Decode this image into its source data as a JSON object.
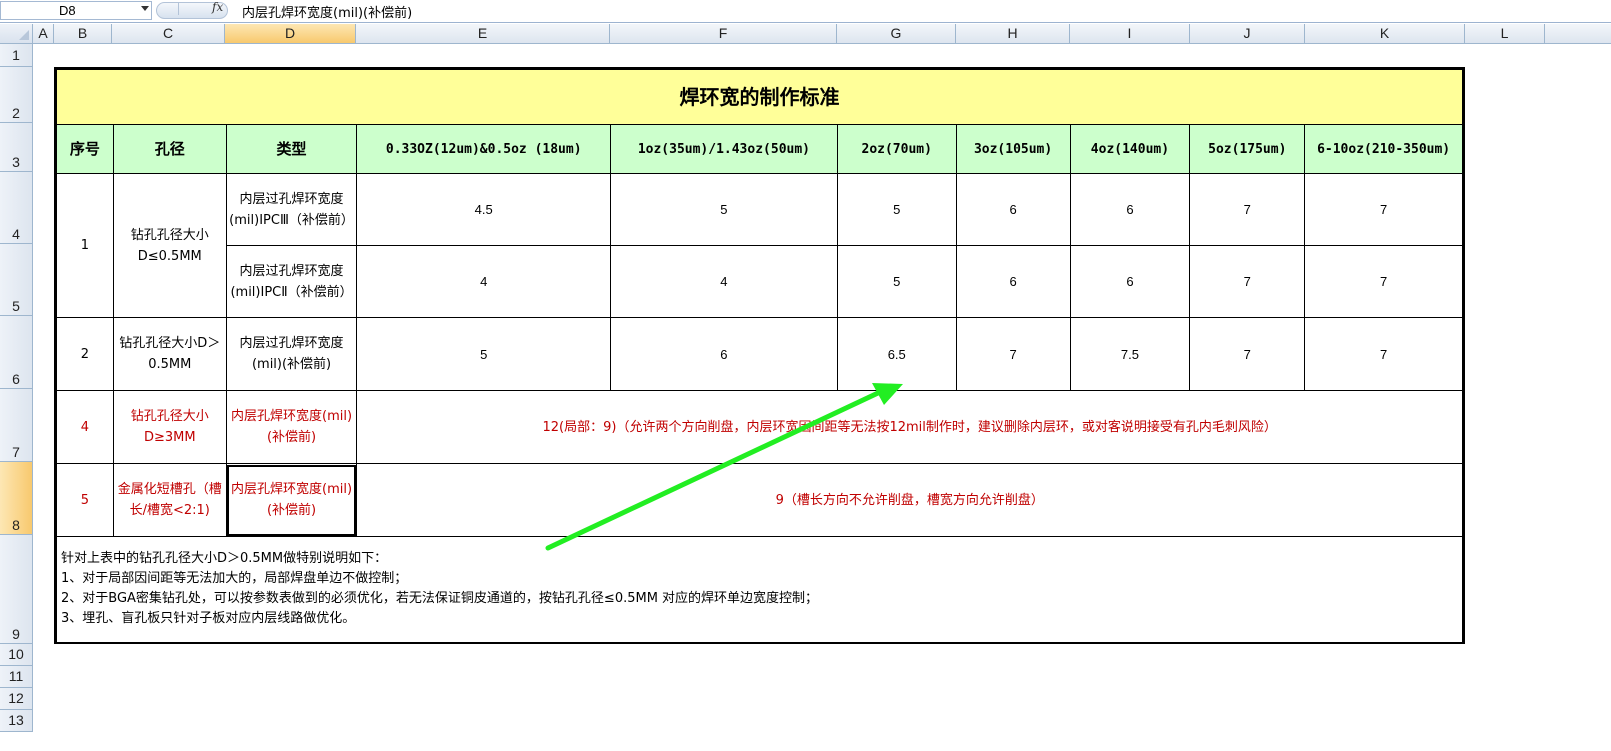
{
  "formula_bar": {
    "cell_ref": "D8",
    "fx": "fx",
    "content": "内层孔焊环宽度(mil)(补偿前)"
  },
  "columns": [
    "A",
    "B",
    "C",
    "D",
    "E",
    "F",
    "G",
    "H",
    "I",
    "J",
    "K",
    "L"
  ],
  "selected_column": "D",
  "rows": [
    "1",
    "2",
    "3",
    "4",
    "5",
    "6",
    "7",
    "8",
    "9",
    "10",
    "11",
    "12",
    "13"
  ],
  "selected_row": "8",
  "table": {
    "title": "焊环宽的制作标准",
    "headers": {
      "seq": "序号",
      "hole": "孔径",
      "type": "类型",
      "c1": "0.33OZ(12um)&0.5oz (18um)",
      "c2": "1oz(35um)/1.43oz(50um)",
      "c3": "2oz(70um)",
      "c4": "3oz(105um)",
      "c5": "4oz(140um)",
      "c6": "5oz(175um)",
      "c7": "6-10oz(210-350um)"
    },
    "rows": [
      {
        "seq": "1",
        "hole": "钻孔孔径大小D≤0.5MM",
        "type": "内层过孔焊环宽度(mil)IPCⅢ（补偿前）",
        "values": [
          "4.5",
          "5",
          "5",
          "6",
          "6",
          "7",
          "7"
        ]
      },
      {
        "type": "内层过孔焊环宽度(mil)IPCⅡ（补偿前）",
        "values": [
          "4",
          "4",
          "5",
          "6",
          "6",
          "7",
          "7"
        ]
      },
      {
        "seq": "2",
        "hole": "钻孔孔径大小D＞0.5MM",
        "type": "内层过孔焊环宽度(mil)(补偿前)",
        "values": [
          "5",
          "6",
          "6.5",
          "7",
          "7.5",
          "7",
          "7"
        ]
      },
      {
        "seq": "4",
        "hole": "钻孔孔径大小D≥3MM",
        "type": "内层孔焊环宽度(mil)(补偿前)",
        "merged": "12(局部：9)（允许两个方向削盘，内层环宽因间距等无法按12mil制作时，建议删除内层环，或对客说明接受有孔内毛刺风险）"
      },
      {
        "seq": "5",
        "hole": "金属化短槽孔（槽长/槽宽<2:1)",
        "type": "内层孔焊环宽度(mil)(补偿前)",
        "merged": "9（槽长方向不允许削盘，槽宽方向允许削盘）"
      }
    ],
    "notes": [
      "针对上表中的钻孔孔径大小D＞0.5MM做特别说明如下：",
      "1、对于局部因间距等无法加大的，局部焊盘单边不做控制；",
      "2、对于BGA密集钻孔处，可以按参数表做到的必须优化，若无法保证铜皮通道的，按钻孔孔径≤0.5MM 对应的焊环单边宽度控制；",
      "3、埋孔、盲孔板只针对子板对应内层线路做优化。"
    ]
  },
  "colors": {
    "title_bg": "#ffff99",
    "header_bg": "#ccffcc",
    "red_text": "#c00000",
    "arrow": "#22ee22",
    "selected_header": "#f8c96e"
  }
}
